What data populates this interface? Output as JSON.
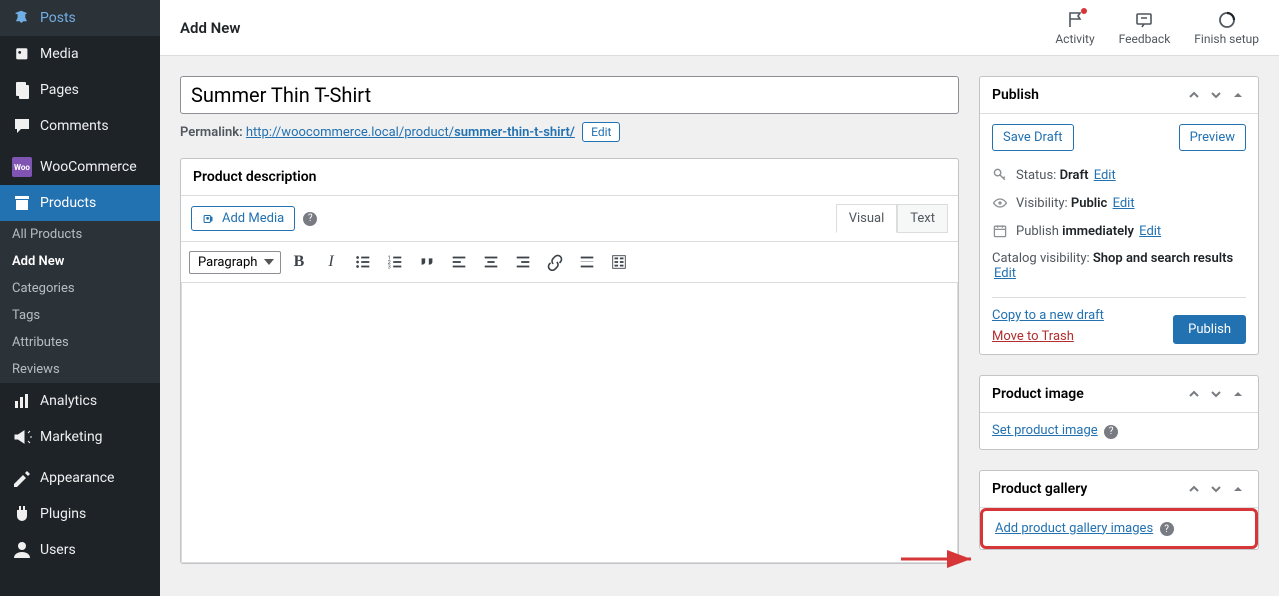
{
  "page_title": "Add New",
  "sidebar": {
    "items": [
      {
        "label": "Posts"
      },
      {
        "label": "Media"
      },
      {
        "label": "Pages"
      },
      {
        "label": "Comments"
      },
      {
        "label": "WooCommerce"
      },
      {
        "label": "Products"
      },
      {
        "label": "Analytics"
      },
      {
        "label": "Marketing"
      },
      {
        "label": "Appearance"
      },
      {
        "label": "Plugins"
      },
      {
        "label": "Users"
      }
    ],
    "submenu": [
      {
        "label": "All Products"
      },
      {
        "label": "Add New"
      },
      {
        "label": "Categories"
      },
      {
        "label": "Tags"
      },
      {
        "label": "Attributes"
      },
      {
        "label": "Reviews"
      }
    ]
  },
  "topbar_actions": [
    {
      "label": "Activity"
    },
    {
      "label": "Feedback"
    },
    {
      "label": "Finish setup"
    }
  ],
  "product_title": "Summer Thin T-Shirt",
  "permalink": {
    "label": "Permalink:",
    "base": "http://woocommerce.local/product/",
    "slug": "summer-thin-t-shirt/",
    "edit": "Edit"
  },
  "description": {
    "header": "Product description",
    "add_media": "Add Media",
    "tabs": {
      "visual": "Visual",
      "text": "Text"
    },
    "style": "Paragraph"
  },
  "publish": {
    "header": "Publish",
    "save_draft": "Save Draft",
    "preview": "Preview",
    "status_label": "Status:",
    "status_value": "Draft",
    "visibility_label": "Visibility:",
    "visibility_value": "Public",
    "publish_label": "Publish",
    "publish_value": "immediately",
    "catalog_label": "Catalog visibility:",
    "catalog_value": "Shop and search results",
    "edit": "Edit",
    "copy_link": "Copy to a new draft",
    "trash_link": "Move to Trash",
    "publish_btn": "Publish"
  },
  "product_image": {
    "header": "Product image",
    "set_link": "Set product image"
  },
  "product_gallery": {
    "header": "Product gallery",
    "add_link": "Add product gallery images"
  }
}
